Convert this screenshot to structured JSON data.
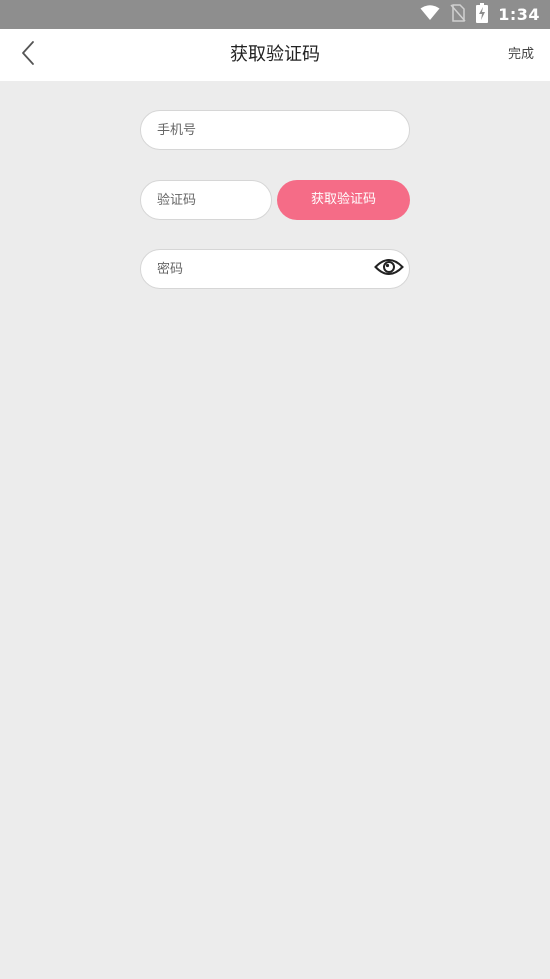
{
  "status_bar": {
    "time": "1:34",
    "icons": [
      "wifi-icon",
      "no-sim-icon",
      "battery-charging-icon"
    ]
  },
  "header": {
    "title": "获取验证码",
    "back_icon": "chevron-left-icon",
    "done_label": "完成"
  },
  "form": {
    "phone": {
      "placeholder": "手机号",
      "value": ""
    },
    "code": {
      "placeholder": "验证码",
      "value": ""
    },
    "get_code_label": "获取验证码",
    "password": {
      "placeholder": "密码",
      "value": ""
    },
    "password_toggle_icon": "eye-icon"
  },
  "colors": {
    "accent": "#f56c87",
    "background": "#ececec",
    "status_bar": "#8e8e8e"
  }
}
